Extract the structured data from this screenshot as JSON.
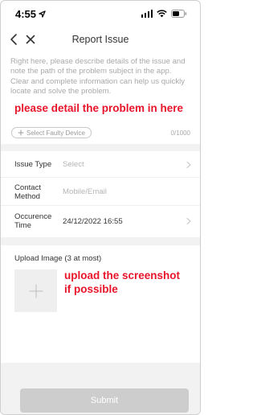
{
  "status_bar": {
    "time": "4:55"
  },
  "nav": {
    "title": "Report Issue"
  },
  "description": {
    "placeholder": "Right here, please describe details of the issue and note the path of the problem subject in the app. Clear and complete information can help us quickly locate and solve the problem.",
    "annotation": "please detail the problem in here",
    "faulty_device_label": "Select Faulty Device",
    "char_count": "0/1000"
  },
  "form": {
    "issue_type": {
      "label": "Issue Type",
      "value": "Select"
    },
    "contact_method": {
      "label_line1": "Contact",
      "label_line2": "Method",
      "placeholder": "Mobile/Email"
    },
    "occurence_time": {
      "label_line1": "Occurence",
      "label_line2": "Time",
      "value": "24/12/2022 16:55"
    }
  },
  "upload": {
    "label": "Upload Image (3 at most)",
    "annotation_line1": "upload the screenshot",
    "annotation_line2": "if possible"
  },
  "submit": {
    "label": "Submit"
  },
  "colors": {
    "annotation": "#e8142a",
    "placeholder": "#a9a9a9",
    "band": "#f2f2f2",
    "submit_disabled": "#cdcdcd"
  },
  "icons": [
    "location-arrow-icon",
    "signal-icon",
    "wifi-icon",
    "battery-icon",
    "back-chevron-icon",
    "close-icon",
    "plus-icon",
    "chevron-right-icon"
  ]
}
